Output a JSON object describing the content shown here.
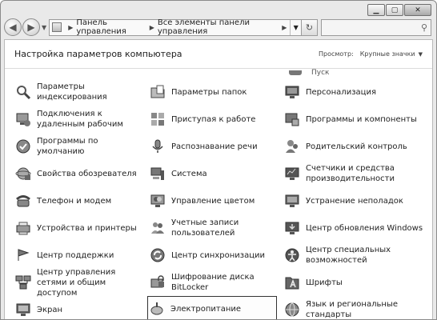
{
  "address": {
    "crumb1": "Панель управления",
    "crumb2": "Все элементы панели управления"
  },
  "header": {
    "title": "Настройка параметров компьютера",
    "view_label": "Просмотр:",
    "view_value": "Крупные значки"
  },
  "partial_item": "Пуск",
  "items": [
    {
      "label": "Параметры индексирования",
      "icon": "indexing-icon"
    },
    {
      "label": "Подключения к удаленным рабочим",
      "icon": "remote-connections-icon"
    },
    {
      "label": "Программы по умолчанию",
      "icon": "default-programs-icon"
    },
    {
      "label": "Свойства обозревателя",
      "icon": "internet-options-icon"
    },
    {
      "label": "Телефон и модем",
      "icon": "phone-modem-icon"
    },
    {
      "label": "Устройства и принтеры",
      "icon": "devices-printers-icon"
    },
    {
      "label": "Центр поддержки",
      "icon": "action-center-icon"
    },
    {
      "label": "Центр управления сетями и общим доступом",
      "icon": "network-center-icon"
    },
    {
      "label": "Экран",
      "icon": "display-icon"
    },
    {
      "label": "Параметры папок",
      "icon": "folder-options-icon"
    },
    {
      "label": "Приступая к работе",
      "icon": "getting-started-icon"
    },
    {
      "label": "Распознавание речи",
      "icon": "speech-recognition-icon"
    },
    {
      "label": "Система",
      "icon": "system-icon"
    },
    {
      "label": "Управление цветом",
      "icon": "color-management-icon"
    },
    {
      "label": "Учетные записи пользователей",
      "icon": "user-accounts-icon"
    },
    {
      "label": "Центр синхронизации",
      "icon": "sync-center-icon"
    },
    {
      "label": "Шифрование диска BitLocker",
      "icon": "bitlocker-icon"
    },
    {
      "label": "Электропитание",
      "icon": "power-options-icon"
    },
    {
      "label": "Персонализация",
      "icon": "personalization-icon"
    },
    {
      "label": "Программы и компоненты",
      "icon": "programs-features-icon"
    },
    {
      "label": "Родительский контроль",
      "icon": "parental-controls-icon"
    },
    {
      "label": "Счетчики и средства производительности",
      "icon": "performance-icon"
    },
    {
      "label": "Устранение неполадок",
      "icon": "troubleshooting-icon"
    },
    {
      "label": "Центр обновления Windows",
      "icon": "windows-update-icon"
    },
    {
      "label": "Центр специальных возможностей",
      "icon": "ease-of-access-icon"
    },
    {
      "label": "Шрифты",
      "icon": "fonts-icon"
    },
    {
      "label": "Язык и региональные стандарты",
      "icon": "region-language-icon"
    }
  ]
}
